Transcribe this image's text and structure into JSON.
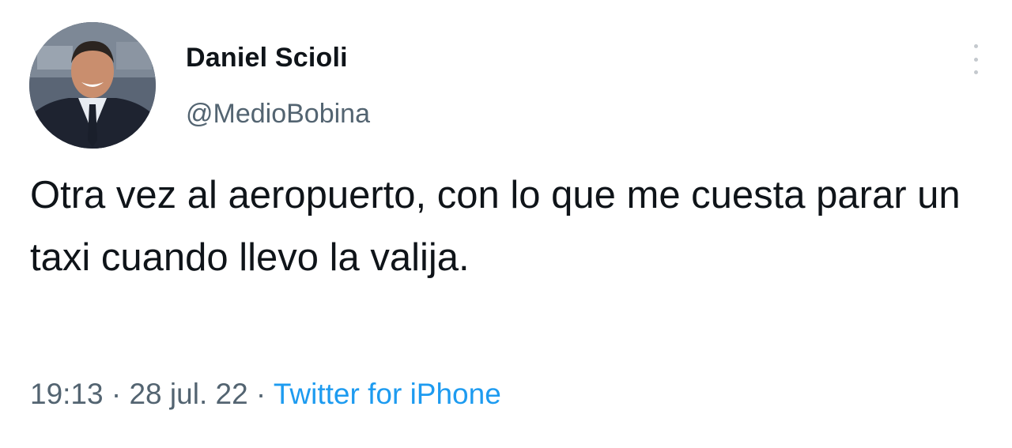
{
  "author": {
    "display_name": "Daniel Scioli",
    "handle": "@MedioBobina"
  },
  "tweet": {
    "text": "Otra vez al aeropuerto, con lo que me cuesta parar un taxi cuando llevo la valija."
  },
  "meta": {
    "time": "19:13",
    "separator_1": " · ",
    "date": "28 jul. 22",
    "separator_2": " · ",
    "source": "Twitter for iPhone"
  },
  "icons": {
    "more": "more-vertical-icon"
  },
  "colors": {
    "text_primary": "#0f1419",
    "text_secondary": "#536471",
    "link": "#1d9bf0"
  }
}
